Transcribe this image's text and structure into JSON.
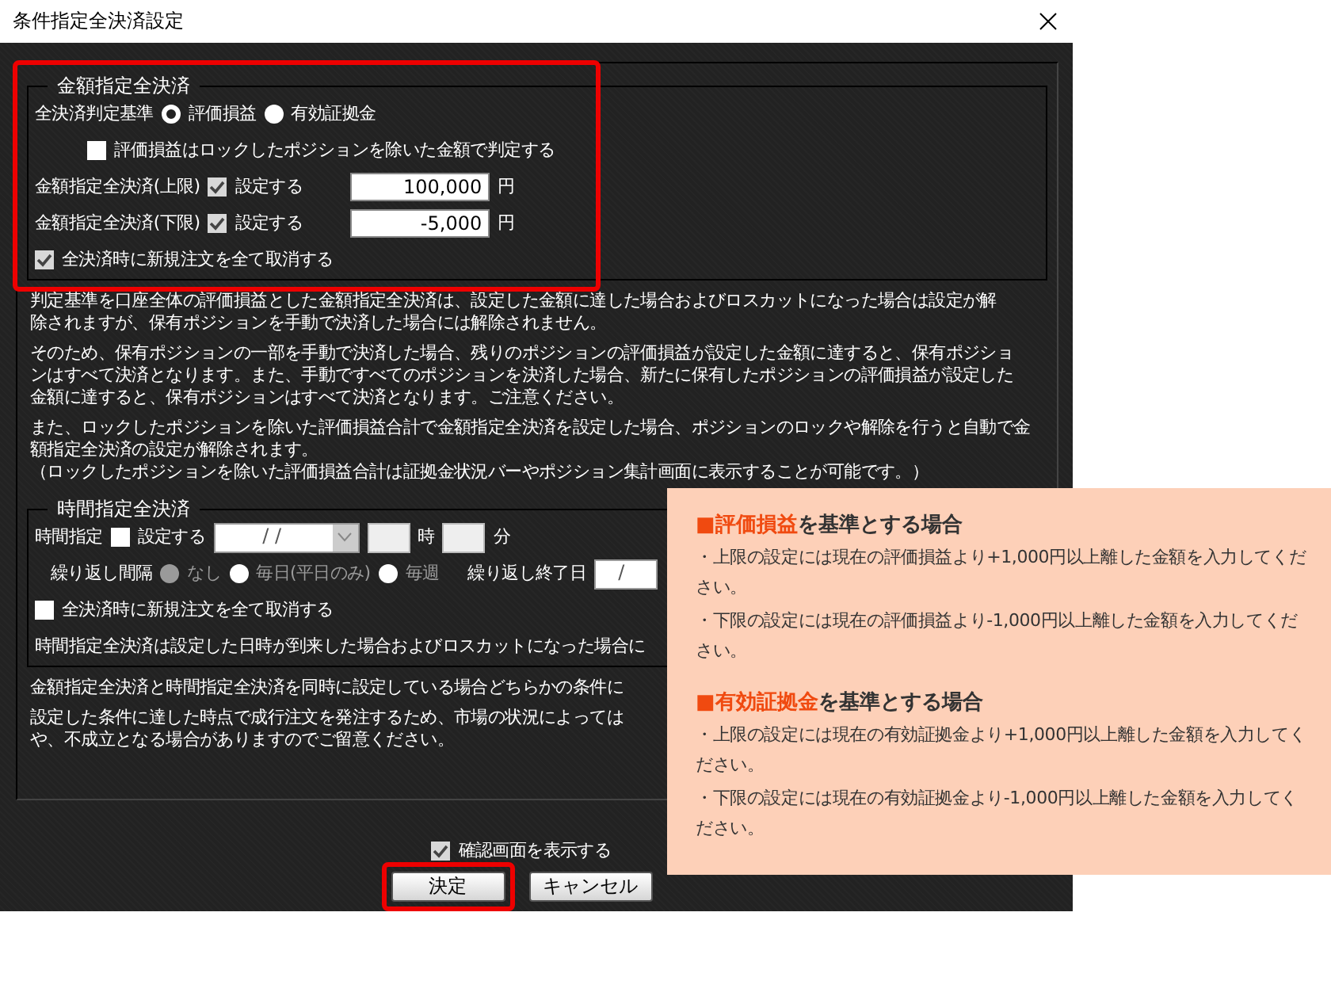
{
  "window": {
    "title": "条件指定全決済設定"
  },
  "amount_group": {
    "title": "金額指定全決済",
    "criterion": {
      "label": "全決済判定基準",
      "options": [
        {
          "label": "評価損益",
          "selected": true
        },
        {
          "label": "有効証拠金",
          "selected": false
        }
      ]
    },
    "exclude_locked": {
      "label": "評価損益はロックしたポジションを除いた金額で判定する",
      "checked": false
    },
    "limits": [
      {
        "label": "金額指定全決済(上限)",
        "toggle": {
          "label": "設定する",
          "checked": true
        },
        "value": "100,000",
        "unit": "円"
      },
      {
        "label": "金額指定全決済(下限)",
        "toggle": {
          "label": "設定する",
          "checked": true
        },
        "value": "-5,000",
        "unit": "円"
      }
    ],
    "cancel_new_orders": {
      "label": "全決済時に新規注文を全て取消する",
      "checked": true
    }
  },
  "amount_notes": [
    {
      "lines": [
        "判定基準を口座全体の評価損益とした金額指定全決済は、設定した金額に達した場合およびロスカットになった場合は設定が解",
        "除されますが、保有ポジションを手動で決済した場合には解除されません。"
      ]
    },
    {
      "lines": [
        "そのため、保有ポジションの一部を手動で決済した場合、残りのポジションの評価損益が設定した金額に達すると、保有ポジショ",
        "ンはすべて決済となります。また、手動ですべてのポジションを決済した場合、新たに保有したポジションの評価損益が設定した",
        "金額に達すると、保有ポジションはすべて決済となります。ご注意ください。"
      ]
    },
    {
      "lines": [
        "また、ロックしたポジションを除いた評価損益合計で金額指定全決済を設定した場合、ポジションのロックや解除を行うと自動で金",
        "額指定全決済の設定が解除されます。",
        "（ロックしたポジションを除いた評価損益合計は証拠金状況バーやポジション集計画面に表示することが可能です。）"
      ]
    }
  ],
  "time_group": {
    "title": "時間指定全決済",
    "time_row": {
      "label": "時間指定",
      "toggle": {
        "label": "設定する",
        "checked": false
      },
      "date": "/ /",
      "hour_unit": "時",
      "minute_unit": "分"
    },
    "repeat": {
      "label": "繰り返し間隔",
      "options": [
        {
          "label": "なし",
          "selected": true
        },
        {
          "label": "毎日(平日のみ)",
          "selected": false
        },
        {
          "label": "毎週",
          "selected": false
        }
      ],
      "disabled": true,
      "end_label": "繰り返し終了日",
      "end_date": "/"
    },
    "cancel_new_orders": {
      "label": "全決済時に新規注文を全て取消する",
      "checked": false
    },
    "note": "時間指定全決済は設定した日時が到来した場合およびロスカットになった場合に"
  },
  "bottom_notes": [
    {
      "lines": [
        "金額指定全決済と時間指定全決済を同時に設定している場合どちらかの条件に"
      ]
    },
    {
      "lines": [
        "設定した条件に達した時点で成行注文を発注するため、市場の状況によっては",
        "や、不成立となる場合がありますのでご留意ください。"
      ]
    }
  ],
  "confirm": {
    "label": "確認画面を表示する",
    "checked": true
  },
  "buttons": [
    {
      "label": "決定",
      "highlighted": true
    },
    {
      "label": "キャンセル",
      "highlighted": false
    }
  ],
  "callout": {
    "sections": [
      {
        "accent": "■評価損益",
        "rest": "を基準とする場合",
        "bullets": [
          "・上限の設定には現在の評価損益より+1,000円以上離した金額を入力してください。",
          "・下限の設定には現在の評価損益より-1,000円以上離した金額を入力してください。"
        ]
      },
      {
        "accent": "■有効証拠金",
        "rest": "を基準とする場合",
        "bullets": [
          "・上限の設定には現在の有効証拠金より+1,000円以上離した金額を入力してください。",
          "・下限の設定には現在の有効証拠金より-1,000円以上離した金額を入力してください。"
        ]
      }
    ]
  }
}
